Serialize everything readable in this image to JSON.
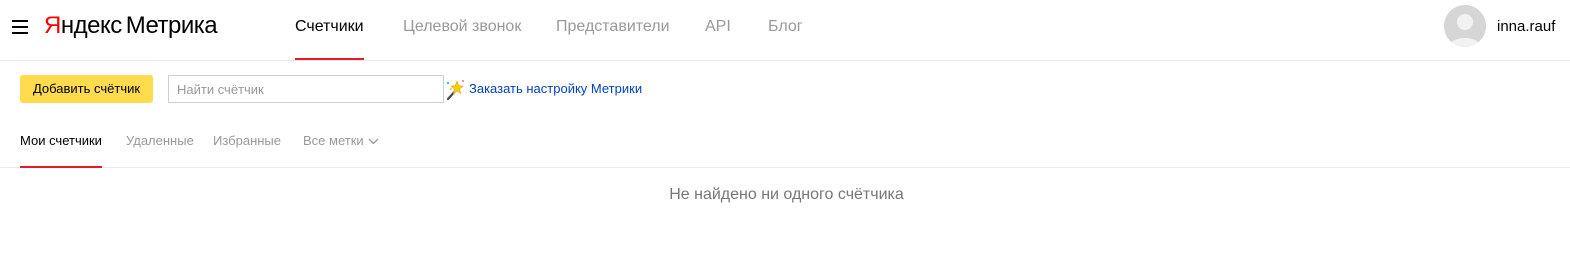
{
  "header": {
    "menu_icon": "hamburger-menu-icon",
    "logo": {
      "brand_first": "Я",
      "brand_rest": "ндекс",
      "product": "Метрика"
    },
    "nav": [
      {
        "label": "Счетчики",
        "active": true
      },
      {
        "label": "Целевой звонок",
        "active": false
      },
      {
        "label": "Представители",
        "active": false
      },
      {
        "label": "API",
        "active": false
      },
      {
        "label": "Блог",
        "active": false
      }
    ],
    "user": {
      "name": "inna.rauf",
      "avatar_icon": "user-avatar-icon"
    }
  },
  "toolbar": {
    "add_label": "Добавить счётчик",
    "search_placeholder": "Найти счётчик",
    "search_value": "",
    "order_link": "Заказать настройку Метрики",
    "order_icon": "magic-wand-icon"
  },
  "tabs": [
    {
      "label": "Мои счетчики",
      "active": true
    },
    {
      "label": "Удаленные",
      "active": false
    },
    {
      "label": "Избранные",
      "active": false
    },
    {
      "label": "Все метки",
      "active": false,
      "dropdown": true
    }
  ],
  "empty_message": "Не найдено ни одного счётчика",
  "colors": {
    "accent_red": "#e21a2c",
    "button_yellow": "#ffdb4d",
    "link_blue": "#0044bb",
    "muted_text": "#999999"
  }
}
